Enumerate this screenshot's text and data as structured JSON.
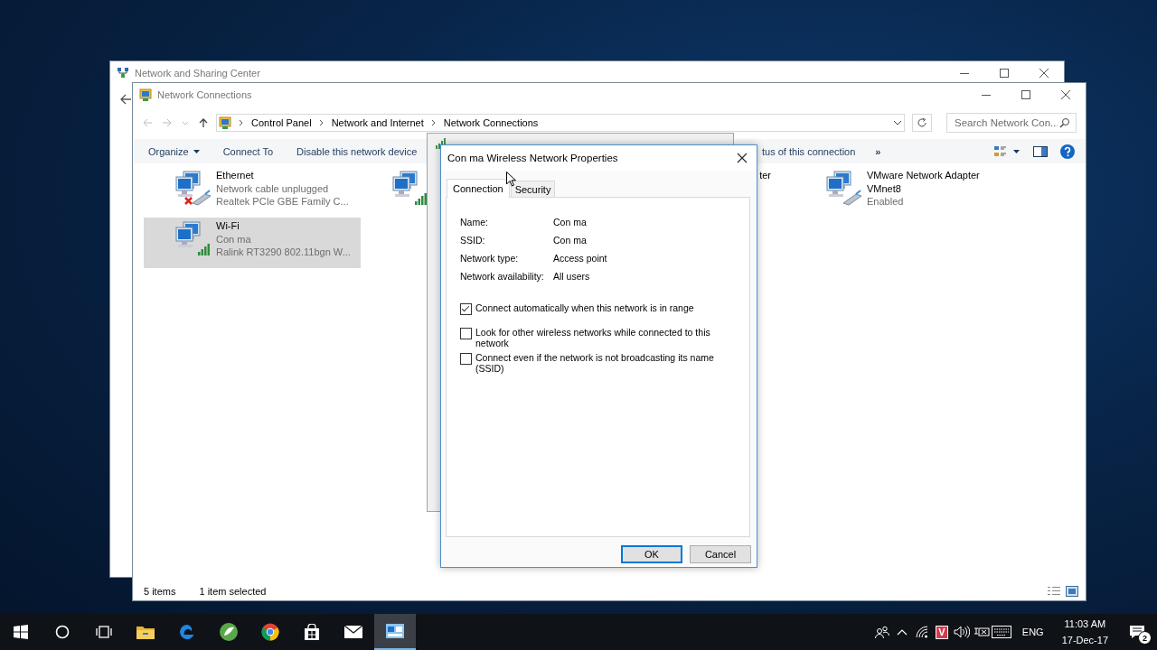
{
  "back_window": {
    "title": "Network and Sharing Center"
  },
  "window": {
    "title": "Network Connections",
    "breadcrumb": [
      "Control Panel",
      "Network and Internet",
      "Network Connections"
    ],
    "search": {
      "placeholder": "Search Network Con..."
    },
    "toolbar": [
      {
        "label": "Organize",
        "kind": "menu"
      },
      {
        "label": "Connect To",
        "kind": "button"
      },
      {
        "label": "Disable this network device",
        "kind": "button"
      },
      {
        "label": "tus of this connection",
        "kind": "cut"
      },
      {
        "label": "»",
        "kind": "more"
      }
    ],
    "items": [
      {
        "kind": "wired",
        "name": "Ethernet",
        "status": "Network cable unplugged",
        "device": "Realtek PCIe GBE Family C...",
        "disconnected": true,
        "selected": false
      },
      {
        "kind": "wireless",
        "disconnected": false,
        "selected": false
      },
      {
        "kind": "cut",
        "name": "ter",
        "selected": false
      },
      {
        "kind": "wired",
        "name": "VMware Network Adapter VMnet8",
        "status": "Enabled",
        "disconnected": false,
        "selected": false
      },
      {
        "kind": "wireless",
        "name": "Wi-Fi",
        "status": "Con ma",
        "device": "Ralink RT3290 802.11bgn W...",
        "disconnected": false,
        "selected": true
      }
    ],
    "status_bar": {
      "count": "5 items",
      "selection": "1 item selected"
    }
  },
  "dialog": {
    "title": "Con ma Wireless Network Properties",
    "tabs": [
      {
        "label": "Connection",
        "selected": true
      },
      {
        "label": "Security",
        "selected": false
      }
    ],
    "fields": [
      {
        "label": "Name:",
        "value": "Con ma"
      },
      {
        "label": "SSID:",
        "value": "Con ma"
      },
      {
        "label": "Network type:",
        "value": "Access point"
      },
      {
        "label": "Network availability:",
        "value": "All users"
      }
    ],
    "options": [
      {
        "label": "Connect automatically when this network is in range",
        "checked": true
      },
      {
        "label": "Look for other wireless networks while connected to this network",
        "checked": false
      },
      {
        "label": "Connect even if the network is not broadcasting its name (SSID)",
        "checked": false
      }
    ],
    "buttons": [
      {
        "label": "OK",
        "default": true
      },
      {
        "label": "Cancel",
        "default": false
      }
    ]
  },
  "taskbar": {
    "apps": [
      {
        "kind": "start",
        "active": false
      },
      {
        "kind": "search",
        "active": false
      },
      {
        "kind": "taskview",
        "active": false
      },
      {
        "kind": "explorer",
        "active": false
      },
      {
        "kind": "edge",
        "active": false
      },
      {
        "kind": "greenapp",
        "active": false
      },
      {
        "kind": "chrome",
        "active": false
      },
      {
        "kind": "store",
        "active": false
      },
      {
        "kind": "mail",
        "active": false
      },
      {
        "kind": "network",
        "active": true
      }
    ],
    "tray": [
      {
        "kind": "people"
      },
      {
        "kind": "chevron"
      },
      {
        "kind": "wifi"
      },
      {
        "kind": "badge",
        "text": "V"
      },
      {
        "kind": "volume"
      },
      {
        "kind": "power"
      },
      {
        "kind": "keyboard"
      }
    ],
    "language": "ENG",
    "time": "11:03 AM",
    "date": "17-Dec-17",
    "notifications": "2"
  }
}
